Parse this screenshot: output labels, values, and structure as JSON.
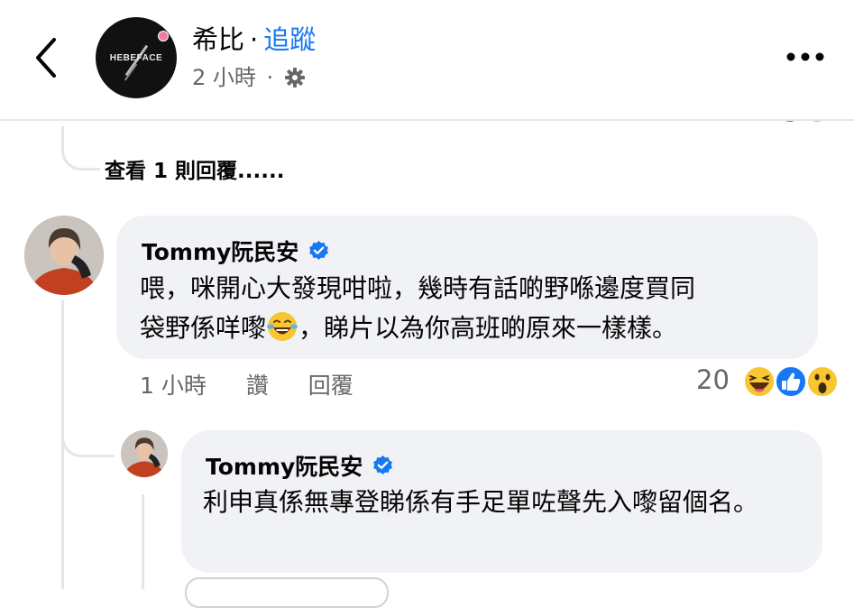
{
  "header": {
    "page_name": "希比",
    "separator": "·",
    "follow_label": "追蹤",
    "time": "2 小時",
    "time_separator": "·",
    "avatar_logo_text": "HEBEFACE",
    "back_icon": "chevron-left-icon",
    "more_icon": "more-horizontal-icon",
    "privacy_icon": "gear-icon"
  },
  "thread": {
    "view_replies_label": "查看 1 則回覆......"
  },
  "comments": [
    {
      "author": "Tommy阮民安",
      "verified": true,
      "text_line1": "喂，咪開心大發現咁啦，幾時有話啲野喺邊度買同",
      "text_line2_before_emoji": "袋野係咩嚟",
      "emoji": "face-with-tears-of-joy",
      "text_line2_after_emoji": "，睇片以為你高班啲原來一樣樣。",
      "time": "1 小時",
      "like_label": "讚",
      "reply_label": "回覆",
      "reaction_count": "20",
      "reactions": [
        "haha",
        "like",
        "wow"
      ]
    },
    {
      "author": "Tommy阮民安",
      "verified": true,
      "text": "利申真係無專登睇係有手足單咗聲先入嚟留個名。"
    }
  ],
  "colors": {
    "accent": "#1877f2",
    "bubble": "#f0f2f5",
    "secondary_text": "#65676b",
    "thread_line": "#e4e6eb"
  }
}
